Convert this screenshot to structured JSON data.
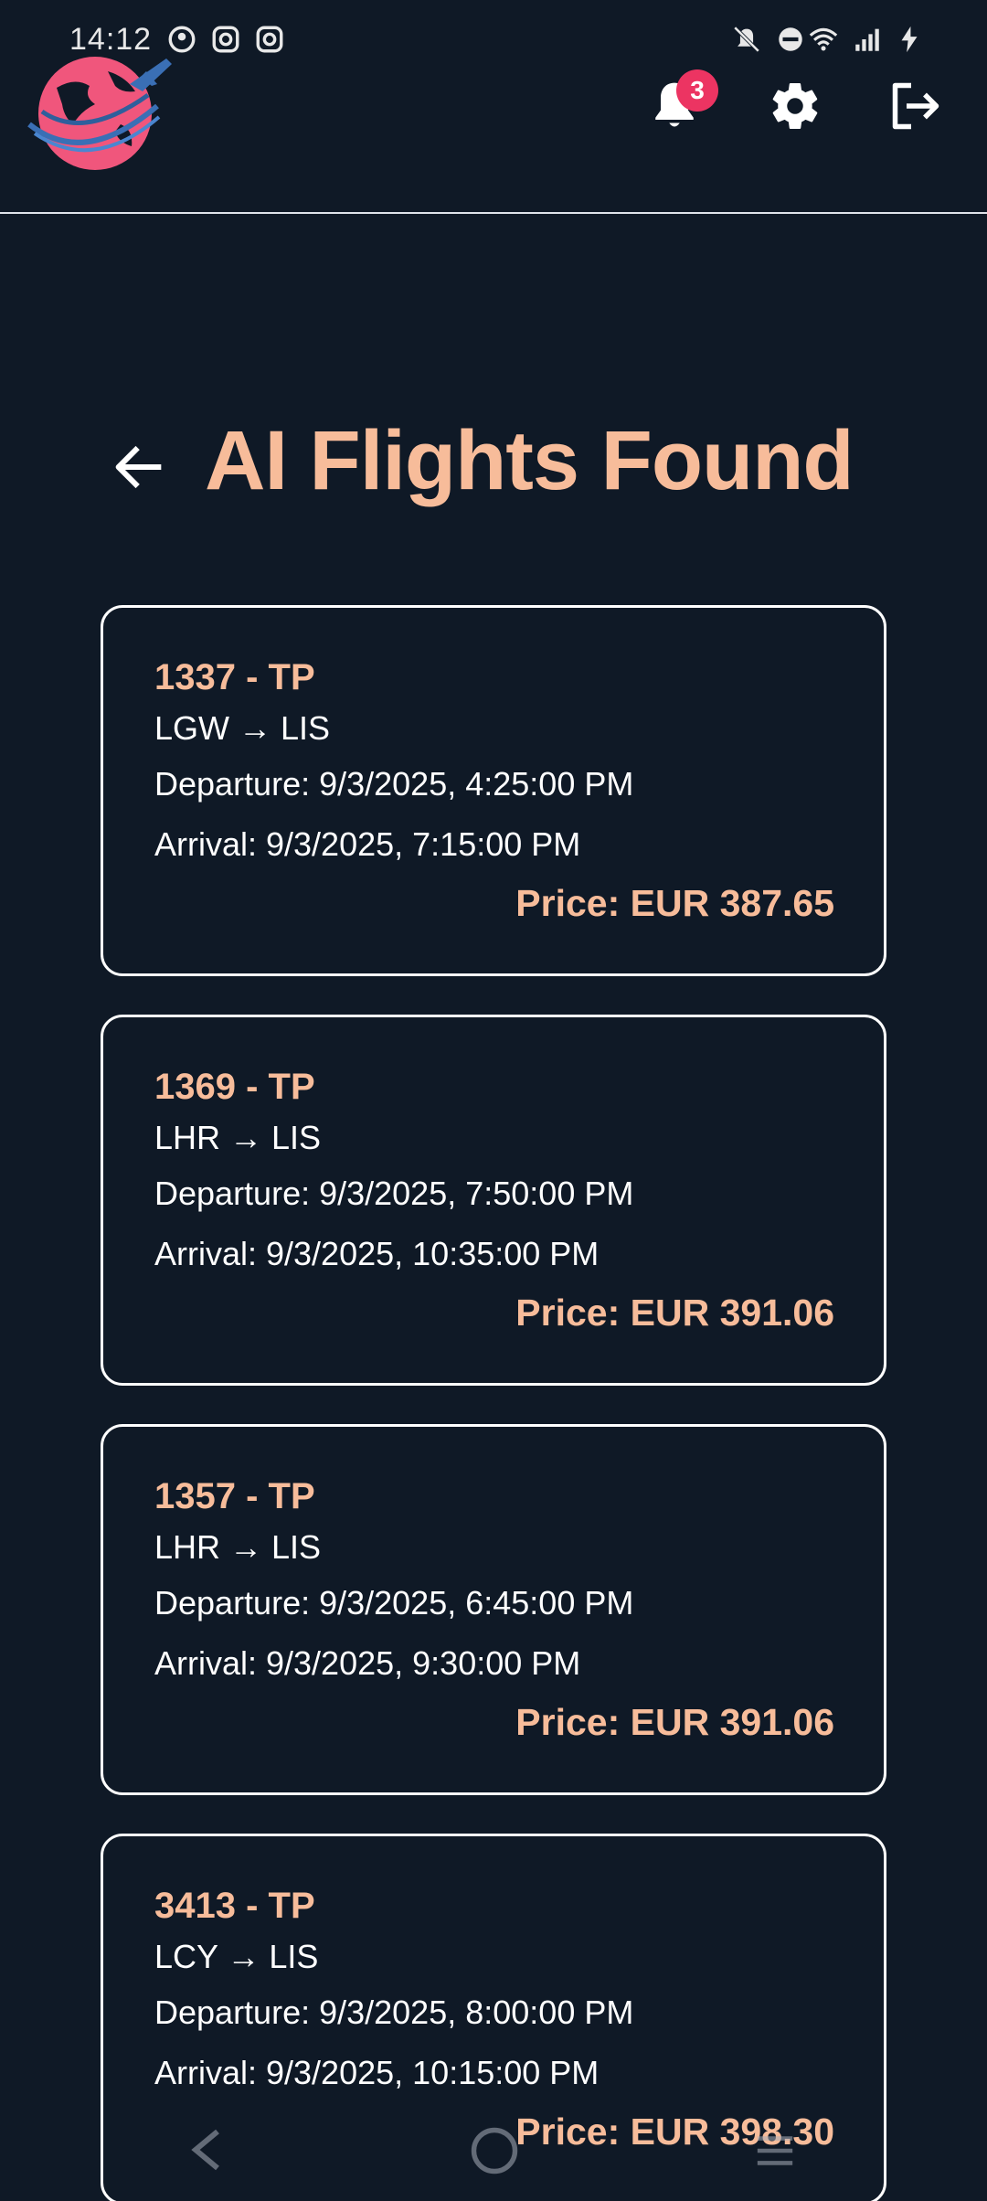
{
  "status_bar": {
    "time": "14:12"
  },
  "header": {
    "notification_count": "3"
  },
  "page": {
    "title": "AI Flights Found"
  },
  "flights": [
    {
      "title": "1337 - TP",
      "route": "LGW → LIS",
      "departure": "Departure: 9/3/2025, 4:25:00 PM",
      "arrival": "Arrival: 9/3/2025, 7:15:00 PM",
      "price": "Price: EUR 387.65"
    },
    {
      "title": "1369 - TP",
      "route": "LHR → LIS",
      "departure": "Departure: 9/3/2025, 7:50:00 PM",
      "arrival": "Arrival: 9/3/2025, 10:35:00 PM",
      "price": "Price: EUR 391.06"
    },
    {
      "title": "1357 - TP",
      "route": "LHR → LIS",
      "departure": "Departure: 9/3/2025, 6:45:00 PM",
      "arrival": "Arrival: 9/3/2025, 9:30:00 PM",
      "price": "Price: EUR 391.06"
    },
    {
      "title": "3413 - TP",
      "route": "LCY → LIS",
      "departure": "Departure: 9/3/2025, 8:00:00 PM",
      "arrival": "Arrival: 9/3/2025, 10:15:00 PM",
      "price": "Price: EUR 398.30"
    }
  ],
  "colors": {
    "background": "#0f1926",
    "accent": "#f7bc9a",
    "badge": "#ec3462",
    "border": "#ffffff"
  },
  "icons": [
    "app-logo-icon",
    "bell-icon",
    "gear-icon",
    "logout-icon",
    "arrow-left-icon"
  ]
}
